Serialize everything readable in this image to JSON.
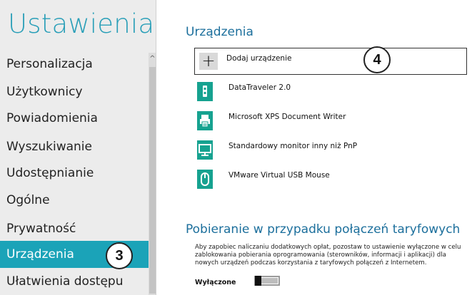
{
  "left_pane": {
    "title": "Ustawienia",
    "scroll_arrow": "^",
    "nav_items": [
      {
        "label": "Personalizacja",
        "active": false
      },
      {
        "label": "Użytkownicy",
        "active": false
      },
      {
        "label": "Powiadomienia",
        "active": false
      },
      {
        "label": "Wyszukiwanie",
        "active": false
      },
      {
        "label": "Udostępnianie",
        "active": false
      },
      {
        "label": "Ogólne",
        "active": false
      },
      {
        "label": "Prywatność",
        "active": false
      },
      {
        "label": "Urządzenia",
        "active": true
      },
      {
        "label": "Ułatwienia dostępu",
        "active": false
      }
    ]
  },
  "devices_section": {
    "title": "Urządzenia",
    "add_device": {
      "icon": "plus-icon",
      "symbol": "+",
      "label": "Dodaj urządzenie"
    },
    "devices": [
      {
        "label": "DataTraveler 2.0",
        "icon": "usb-drive-icon"
      },
      {
        "label": "Microsoft XPS Document Writer",
        "icon": "printer-icon"
      },
      {
        "label": "Standardowy monitor inny niż PnP",
        "icon": "monitor-icon"
      },
      {
        "label": "VMware Virtual USB Mouse",
        "icon": "mouse-icon"
      }
    ]
  },
  "metered_section": {
    "title": "Pobieranie w przypadku połączeń taryfowych",
    "description": "Aby zapobiec naliczaniu dodatkowych opłat, pozostaw to ustawienie wyłączone w celu zablokowania pobierania oprogramowania (sterowników, informacji i aplikacji) dla nowych urządzeń podczas korzystania z taryfowych połączeń z Internetem.",
    "toggle": {
      "label": "Wyłączone",
      "state": "off"
    }
  },
  "callouts": {
    "step_3": "3",
    "step_4": "4"
  },
  "colors": {
    "accent": "#1ba3b8",
    "title_accent": "#2a9fb8",
    "section_title": "#1c6f9c",
    "device_tile": "#16a290",
    "left_background": "#ececec"
  }
}
